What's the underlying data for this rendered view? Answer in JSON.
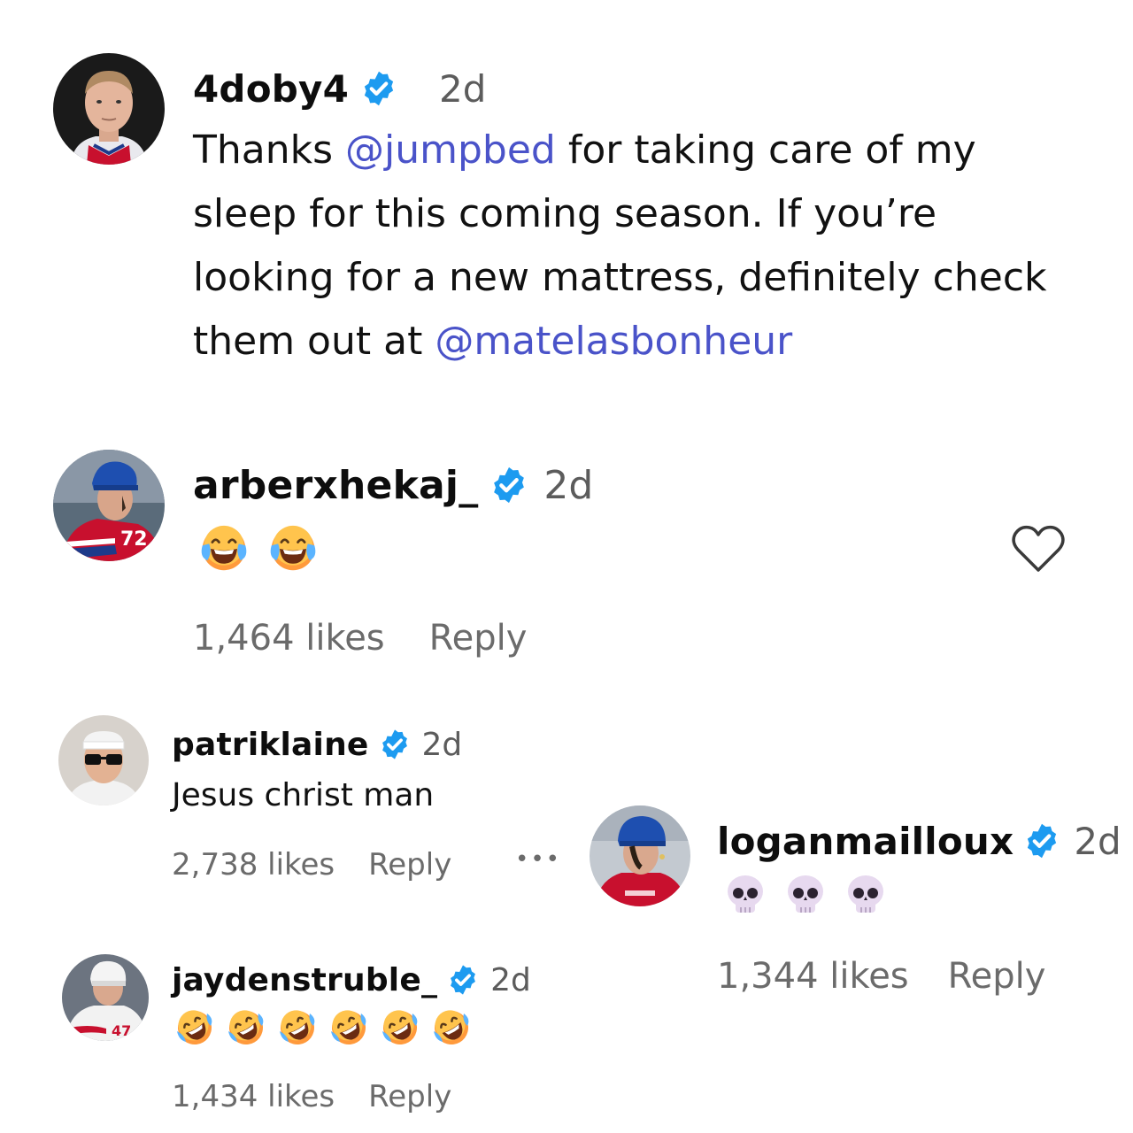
{
  "comments": [
    {
      "username": "4doby4",
      "time": "2d",
      "text_parts": [
        "Thanks ",
        "@jumpbed",
        " for taking care of my sleep for this coming season. If you’re looking for a new mattress, definitely check them out at ",
        "@matelasbonheur"
      ],
      "avatar": "player-portrait"
    },
    {
      "username": "arberxhekaj_",
      "time": "2d",
      "emojis": [
        "face-with-tears-of-joy",
        "face-with-tears-of-joy"
      ],
      "likes": "1,464 likes",
      "reply": "Reply",
      "avatar": "player-in-red-jersey-72",
      "like_icon": "heart-icon"
    },
    {
      "username": "patriklaine",
      "time": "2d",
      "text": "Jesus christ man",
      "likes": "2,738 likes",
      "reply": "Reply",
      "avatar": "man-with-sunglasses-headband"
    },
    {
      "username": "loganmailloux",
      "time": "2d",
      "emojis": [
        "skull",
        "skull",
        "skull"
      ],
      "likes": "1,344 likes",
      "reply": "Reply",
      "avatar": "player-in-blue-helmet"
    },
    {
      "username": "jaydenstruble_",
      "time": "2d",
      "emojis": [
        "rolling-on-the-floor-laughing",
        "rolling-on-the-floor-laughing",
        "rolling-on-the-floor-laughing",
        "rolling-on-the-floor-laughing",
        "rolling-on-the-floor-laughing",
        "rolling-on-the-floor-laughing"
      ],
      "likes": "1,434 likes",
      "reply": "Reply",
      "avatar": "player-in-white-helmet"
    }
  ],
  "more_icon": "more-dots-icon",
  "colors": {
    "mention": "#4a53c9",
    "verified": "#1d9bf0",
    "muted": "#6b6b6b"
  }
}
